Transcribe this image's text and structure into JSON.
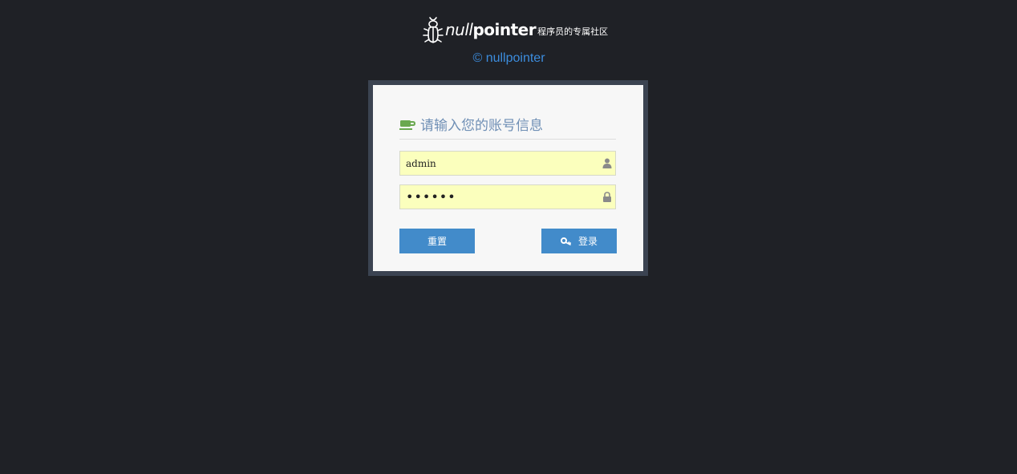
{
  "brand": {
    "name_prefix": "null",
    "name_suffix": "pointer",
    "slogan": "程序员的专属社区",
    "copyright": "© nullpointer"
  },
  "login": {
    "title": "请输入您的账号信息",
    "username": {
      "value": "admin",
      "icon": "user-icon"
    },
    "password": {
      "value": "••••••",
      "icon": "lock-icon"
    },
    "reset_label": "重置",
    "submit_label": "登录"
  },
  "colors": {
    "page_bg": "#1f2126",
    "frame": "#3b4351",
    "panel": "#f7f7f7",
    "accent_blue": "#428bca",
    "copyright_blue": "#3c8dde",
    "title_text": "#6f8fb5",
    "cup_green": "#6aa84f",
    "field_bg": "#fbffbd"
  }
}
